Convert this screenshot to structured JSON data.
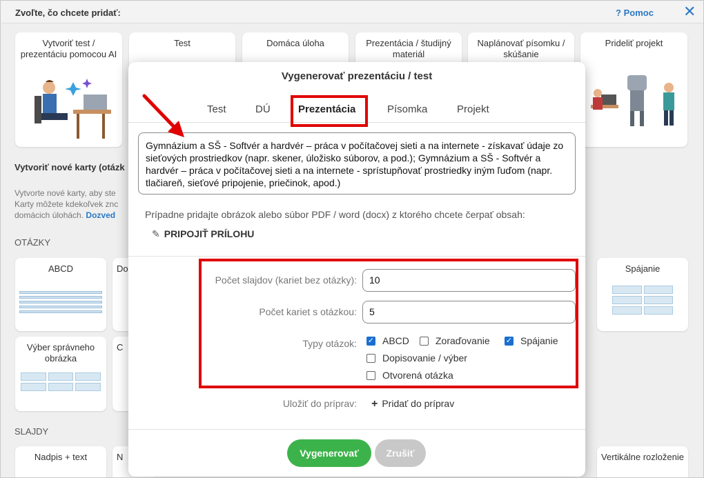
{
  "header": {
    "title": "Zvoľte, čo chcete pridať:",
    "help_label": "Pomoc",
    "help_icon": "?",
    "close_icon": "✕"
  },
  "top_cards": [
    {
      "label": "Vytvoriť test / prezentáciu pomocou AI"
    },
    {
      "label": "Test"
    },
    {
      "label": "Domáca úloha"
    },
    {
      "label": "Prezentácia / študijný materiál"
    },
    {
      "label": "Naplánovať písomku / skúšanie"
    },
    {
      "label": "Prideliť projekt"
    }
  ],
  "create_cards": {
    "heading": "Vytvoriť nové karty (otázk",
    "text_line1": "Vytvorte nové karty, aby ste",
    "text_line2": "Karty môžete kdekoľvek znc",
    "text_line3": "domácich úlohách.",
    "link": "Dozved"
  },
  "questions_section": {
    "label": "OTÁZKY",
    "cards": [
      {
        "label": "ABCD"
      },
      {
        "label": "Do"
      },
      {
        "label": "Spájanie"
      },
      {
        "label": "Výber správneho obrázka"
      },
      {
        "label": "C"
      }
    ]
  },
  "slides_section": {
    "label": "SLAJDY",
    "cards": [
      {
        "label": "Nadpis + text"
      },
      {
        "label": "N"
      },
      {
        "label": "Vertikálne rozloženie"
      }
    ]
  },
  "modal": {
    "title": "Vygenerovať prezentáciu / test",
    "tabs": [
      "Test",
      "DÚ",
      "Prezentácia",
      "Písomka",
      "Projekt"
    ],
    "active_tab": "Prezentácia",
    "prompt_text": "Gymnázium a SŠ - Softvér a hardvér – práca v počítačovej sieti a na internete - získavať údaje zo sieťových prostriedkov (napr. skener, úložisko súborov, a pod.); Gymnázium a SŠ - Softvér a hardvér – práca v počítačovej sieti a na internete - sprístupňovať prostriedky iným ľuďom (napr. tlačiareň, sieťové pripojenie, priečinok, apod.)",
    "attachment_hint": "Prípadne pridajte obrázok alebo súbor PDF / word (docx) z ktorého chcete čerpať obsah:",
    "attach_label": "PRIPOJIŤ PRÍLOHU",
    "slides_label": "Počet slajdov (kariet bez otázky):",
    "slides_value": "10",
    "question_cards_label": "Počet kariet s otázkou:",
    "question_cards_value": "5",
    "types_label": "Typy otázok:",
    "types": [
      {
        "label": "ABCD",
        "checked": true
      },
      {
        "label": "Zoraďovanie",
        "checked": false
      },
      {
        "label": "Spájanie",
        "checked": true
      },
      {
        "label": "Dopisovanie / výber",
        "checked": false
      },
      {
        "label": "Otvorená otázka",
        "checked": false
      }
    ],
    "save_label": "Uložiť do príprav:",
    "add_prep_label": "Pridať do príprav",
    "generate_label": "Vygenerovať",
    "cancel_label": "Zrušiť"
  },
  "colors": {
    "accent_blue": "#2b78c5",
    "highlight_red": "#e00000",
    "generate_green": "#3cb34a",
    "checkbox_blue": "#1a6fd0"
  }
}
